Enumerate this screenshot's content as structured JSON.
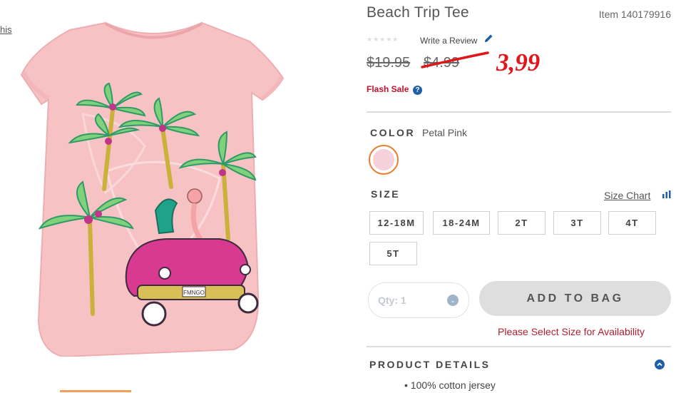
{
  "left_link": "his",
  "product": {
    "title": "Beach Trip Tee",
    "item": "Item 140179916",
    "stars": "★★★★★",
    "review_link": "Write a Review",
    "original_price": "$19.95",
    "sale_price": "$4.99",
    "new_price": "3,99",
    "flash_sale": "Flash Sale",
    "help_icon": "?",
    "image_text": "FMNGO"
  },
  "color": {
    "label": "COLOR",
    "value": "Petal Pink",
    "swatch": "#f6d1dc"
  },
  "size": {
    "label": "SIZE",
    "chart_link": "Size Chart",
    "options": [
      "12-18M",
      "18-24M",
      "2T",
      "3T",
      "4T",
      "5T"
    ]
  },
  "qty": {
    "label": "Qty: 1",
    "chevron": "⌄"
  },
  "add_to_bag": "ADD TO BAG",
  "size_warning": "Please Select Size for Availability",
  "details": {
    "label": "PRODUCT DETAILS",
    "bullet": "• 100% cotton jersey"
  },
  "colors": {
    "price_red": "#e0161a",
    "flash_red": "#c4112a",
    "accent_blue": "#1e5fa8",
    "swatch_border": "#e87f2e"
  }
}
